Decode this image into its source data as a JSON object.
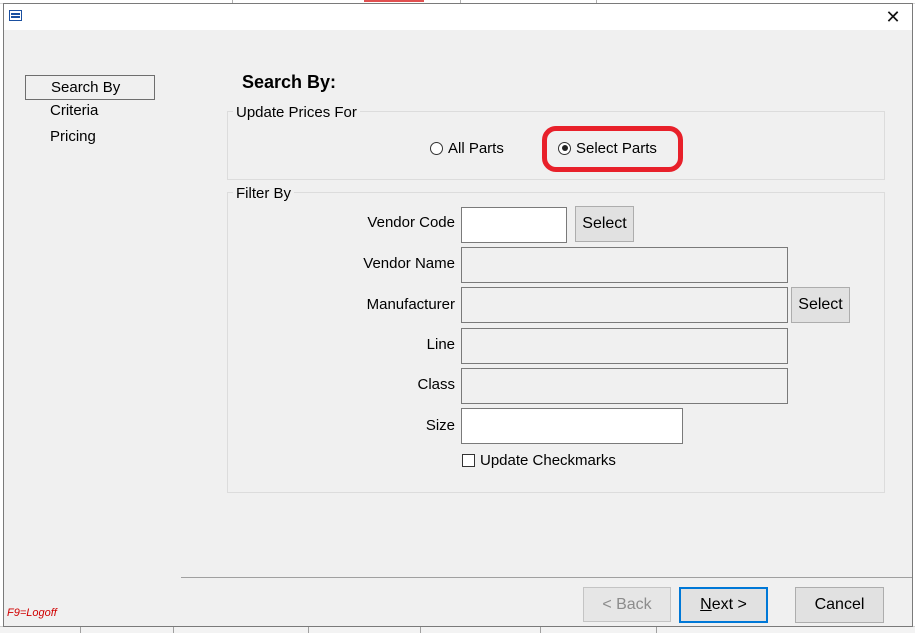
{
  "window": {
    "app_icon": "window-icon",
    "close_symbol": "✕"
  },
  "nav": {
    "items": [
      {
        "label": "Search By",
        "selected": true
      },
      {
        "label": "Criteria",
        "selected": false
      },
      {
        "label": "Pricing",
        "selected": false
      }
    ]
  },
  "main": {
    "heading": "Search By:",
    "update_prices": {
      "title": "Update Prices For",
      "options": [
        {
          "label": "All Parts",
          "checked": false
        },
        {
          "label": "Select Parts",
          "checked": true
        }
      ],
      "highlight_color": "#e8202a"
    },
    "filter": {
      "title": "Filter By",
      "vendor_code": {
        "label": "Vendor Code",
        "value": "",
        "button": "Select"
      },
      "vendor_name": {
        "label": "Vendor Name",
        "value": ""
      },
      "manufacturer": {
        "label": "Manufacturer",
        "value": "",
        "button": "Select"
      },
      "line": {
        "label": "Line",
        "value": ""
      },
      "class": {
        "label": "Class",
        "value": ""
      },
      "size": {
        "label": "Size",
        "value": ""
      },
      "update_checkmarks": {
        "label": "Update Checkmarks",
        "checked": false
      }
    }
  },
  "footer": {
    "logoff": "F9=Logoff",
    "back": "< Back",
    "next": "Next >",
    "cancel": "Cancel"
  },
  "colors": {
    "accent": "#0078d7",
    "logoff_red": "#d00000",
    "dialog_bg": "#f0f0f0"
  }
}
